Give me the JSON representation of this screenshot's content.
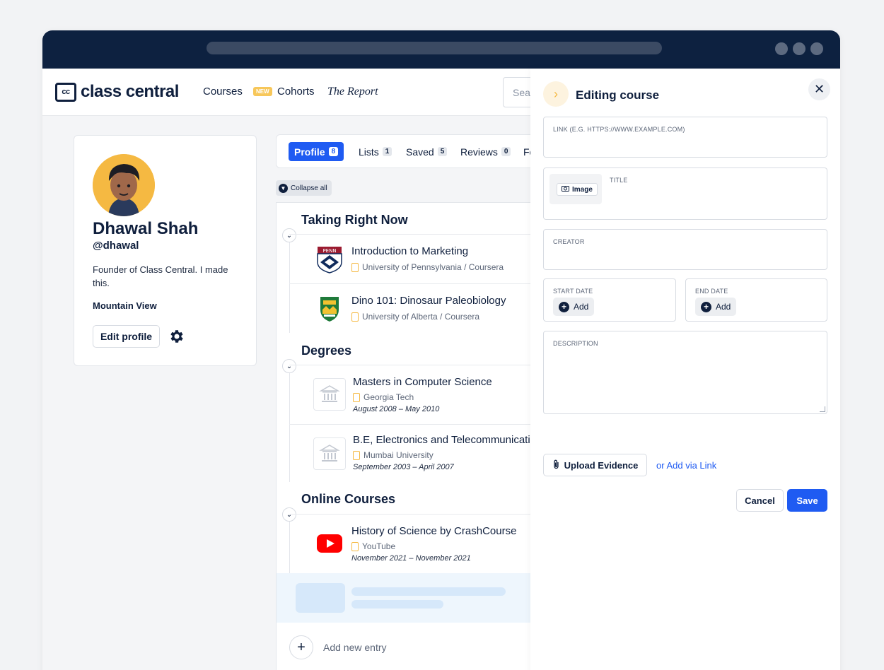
{
  "nav": {
    "logo_box": "cc",
    "logo_text": "class central",
    "courses": "Courses",
    "new_badge": "NEW",
    "cohorts": "Cohorts",
    "report": "The Report",
    "search_placeholder": "Sea"
  },
  "profile": {
    "name": "Dhawal Shah",
    "handle": "@dhawal",
    "bio": "Founder of Class Central. I made this.",
    "location": "Mountain View",
    "edit_label": "Edit profile"
  },
  "tabs": [
    {
      "label": "Profile",
      "count": "8"
    },
    {
      "label": "Lists",
      "count": "1"
    },
    {
      "label": "Saved",
      "count": "5"
    },
    {
      "label": "Reviews",
      "count": "0"
    },
    {
      "label": "Fo",
      "count": ""
    }
  ],
  "collapse_label": "Collapse all",
  "sections": {
    "taking": {
      "title": "Taking Right Now",
      "items": [
        {
          "title": "Introduction to Marketing",
          "sub": "University of Pennsylvania / Coursera"
        },
        {
          "title": "Dino 101: Dinosaur Paleobiology",
          "sub": "University of Alberta / Coursera"
        }
      ]
    },
    "degrees": {
      "title": "Degrees",
      "items": [
        {
          "title": "Masters in Computer Science",
          "sub": "Georgia Tech",
          "date": "August 2008 – May 2010"
        },
        {
          "title": "B.E, Electronics and Telecommunicatio",
          "sub": "Mumbai University",
          "date": "September 2003 – April 2007"
        }
      ]
    },
    "online": {
      "title": "Online Courses",
      "items": [
        {
          "title": "History of Science by CrashCourse",
          "sub": "YouTube",
          "date": "November 2021 – November 2021"
        }
      ]
    }
  },
  "add_entry_label": "Add new entry",
  "editor": {
    "title": "Editing course",
    "link_label": "LINK (E.G. HTTPS://WWW.EXAMPLE.COM)",
    "image_label": "Image",
    "title_label": "TITLE",
    "creator_label": "CREATOR",
    "start_label": "START DATE",
    "end_label": "END DATE",
    "add_label": "Add",
    "description_label": "DESCRIPTION",
    "upload_label": "Upload Evidence",
    "via_link_label": "or Add via Link",
    "cancel_label": "Cancel",
    "save_label": "Save"
  },
  "colors": {
    "primary": "#1f5bf2",
    "navy": "#0d2140",
    "accent": "#f5b942"
  }
}
